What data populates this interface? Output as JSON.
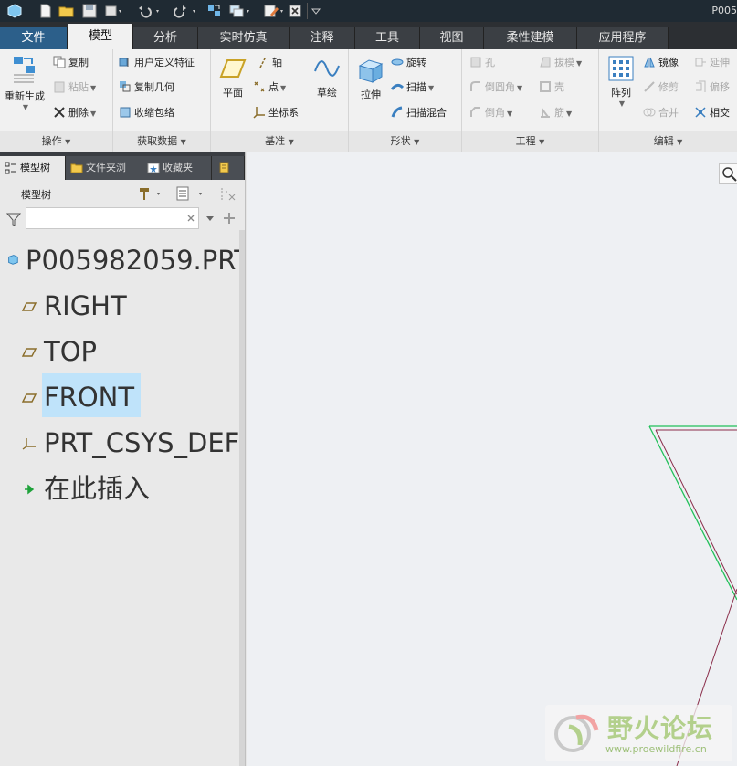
{
  "title_bar": {
    "title": "P005"
  },
  "tabs": [
    {
      "label": "文件"
    },
    {
      "label": "模型"
    },
    {
      "label": "分析"
    },
    {
      "label": "实时仿真"
    },
    {
      "label": "注释"
    },
    {
      "label": "工具"
    },
    {
      "label": "视图"
    },
    {
      "label": "柔性建模"
    },
    {
      "label": "应用程序"
    }
  ],
  "ribbon": {
    "operations": {
      "label": "操作",
      "regenerate": "重新生成",
      "copy": "复制",
      "paste": "粘贴",
      "delete": "删除"
    },
    "get_data": {
      "label": "获取数据",
      "udf": "用户定义特征",
      "copy_geom": "复制几何",
      "shrinkwrap": "收缩包络"
    },
    "datum": {
      "label": "基准",
      "plane": "平面",
      "axis": "轴",
      "point": "点",
      "csys": "坐标系",
      "sketch": "草绘"
    },
    "shapes": {
      "label": "形状",
      "extrude": "拉伸",
      "revolve": "旋转",
      "sweep": "扫描",
      "swept_blend": "扫描混合"
    },
    "engineering": {
      "label": "工程",
      "hole": "孔",
      "round": "倒圆角",
      "chamfer": "倒角",
      "draft": "拔模",
      "shell": "壳",
      "rib": "筋"
    },
    "editing": {
      "label": "编辑",
      "pattern": "阵列",
      "mirror": "镜像",
      "trim": "修剪",
      "merge": "合并",
      "extend": "延伸",
      "offset": "偏移",
      "intersect": "相交"
    }
  },
  "panel": {
    "tabs": [
      {
        "label": "模型树"
      },
      {
        "label": "文件夹浏"
      },
      {
        "label": "收藏夹"
      }
    ],
    "tree_title": "模型树",
    "search_value": ""
  },
  "tree": [
    {
      "label": "P005982059.PRT"
    },
    {
      "label": "RIGHT"
    },
    {
      "label": "TOP"
    },
    {
      "label": "FRONT"
    },
    {
      "label": "PRT_CSYS_DEF"
    },
    {
      "label": "在此插入"
    }
  ],
  "watermark": {
    "title": "野火论坛",
    "url": "www.proewildfire.cn"
  },
  "colors": {
    "ribbon_bg": "#f1f1f1",
    "tab_dark": "#2c2f33",
    "selection": "#bfe3fa",
    "plane_green": "#22c05a",
    "plane_red": "#8a2d4a"
  }
}
